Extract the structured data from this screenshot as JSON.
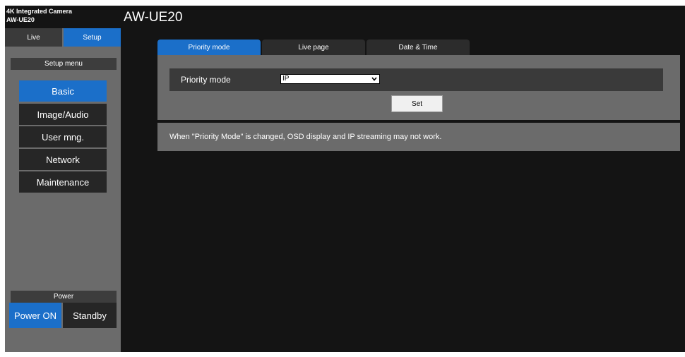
{
  "model": {
    "line1": "4K Integrated Camera",
    "line2": "AW-UE20"
  },
  "app_title": "AW-UE20",
  "top_tabs": {
    "live": "Live",
    "setup": "Setup"
  },
  "setup_menu": {
    "heading": "Setup menu",
    "items": [
      {
        "label": "Basic",
        "active": true
      },
      {
        "label": "Image/Audio"
      },
      {
        "label": "User mng."
      },
      {
        "label": "Network"
      },
      {
        "label": "Maintenance"
      }
    ]
  },
  "power": {
    "heading": "Power",
    "on_label": "Power ON",
    "standby_label": "Standby"
  },
  "content_tabs": [
    {
      "label": "Priority mode",
      "active": true
    },
    {
      "label": "Live page"
    },
    {
      "label": "Date & Time"
    }
  ],
  "priority": {
    "label": "Priority mode",
    "value": "IP",
    "set_label": "Set"
  },
  "notice": "When \"Priority Mode\" is changed, OSD display and IP streaming may not work.",
  "colors": {
    "accent": "#1b6fc9",
    "panel": "#6b6b6b",
    "background": "#141414"
  }
}
